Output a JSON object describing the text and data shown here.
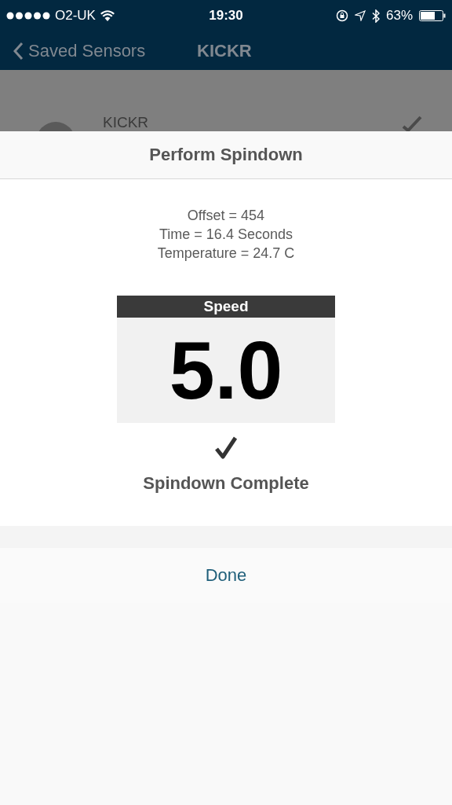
{
  "status_bar": {
    "carrier": "O2-UK",
    "time": "19:30",
    "battery": "63%"
  },
  "nav_bar": {
    "back": "Saved Sensors",
    "title": "KICKR"
  },
  "background_list": [
    {
      "title": "KICKR",
      "checked": true
    }
  ],
  "sheet": {
    "title": "Perform Spindown",
    "readings": [
      "Offset = 454",
      "Time = 16.4 Seconds",
      "Temperature = 24.7 C"
    ],
    "gauge": {
      "label": "Speed",
      "value": "5.0"
    },
    "complete": true,
    "status": "Spindown Complete",
    "button": "Done"
  }
}
